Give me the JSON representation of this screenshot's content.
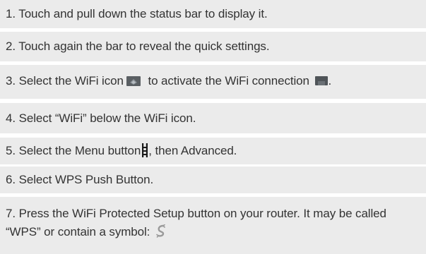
{
  "steps": [
    {
      "text": "1. Touch and pull down the status bar to display it."
    },
    {
      "text": "2. Touch again the bar to reveal the quick settings."
    },
    {
      "text_before": "3. Select the WiFi icon",
      "text_middle": "to activate the WiFi connection",
      "text_after": "."
    },
    {
      "text": "4. Select “WiFi” below the WiFi icon."
    },
    {
      "text_before": "5. Select the Menu button",
      "text_after": ", then Advanced."
    },
    {
      "text": "6. Select WPS Push Button."
    },
    {
      "text": "7. Press the WiFi Protected Setup button on your router. It may be called “WPS” or contain a symbol:"
    }
  ],
  "icons": {
    "wifi_icon": "wifi-icon",
    "wifi_connection_icon": "wifi-connection-icon",
    "menu_icon": "menu-icon",
    "wps_symbol": "wps-icon"
  }
}
